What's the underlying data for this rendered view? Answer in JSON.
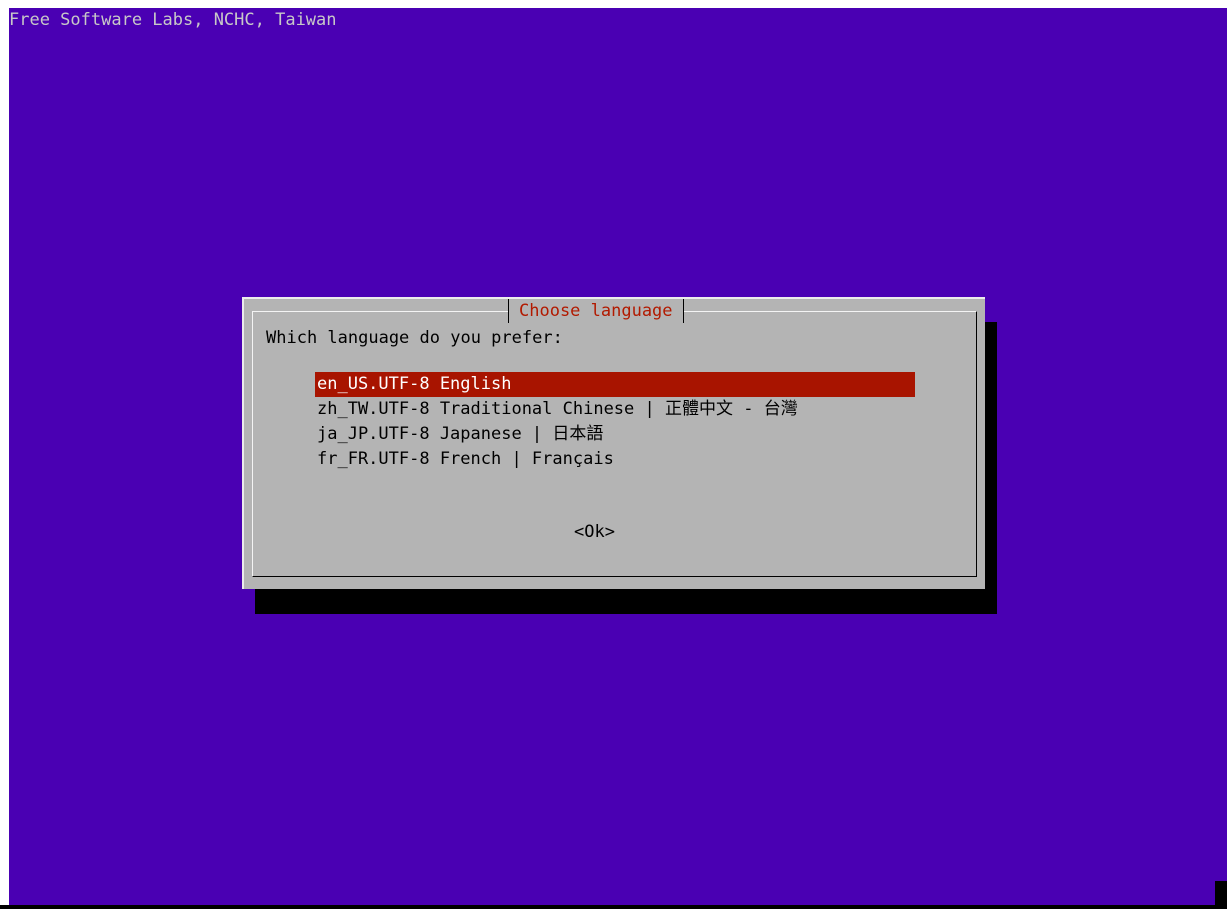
{
  "screen": {
    "backtitle": "Free Software Labs, NCHC, Taiwan",
    "colors": {
      "background": "#4a00b3",
      "dialog": "#b4b4b4",
      "title": "#b21a00",
      "selection": "#a81400"
    }
  },
  "dialog": {
    "title": "Choose language",
    "prompt": "Which language do you prefer:",
    "items": [
      {
        "label": "en_US.UTF-8 English",
        "selected": true
      },
      {
        "label": "zh_TW.UTF-8 Traditional Chinese | 正體中文 - 台灣",
        "selected": false
      },
      {
        "label": "ja_JP.UTF-8 Japanese | 日本語",
        "selected": false
      },
      {
        "label": "fr_FR.UTF-8 French | Français",
        "selected": false
      }
    ],
    "ok_label": "<Ok>"
  }
}
